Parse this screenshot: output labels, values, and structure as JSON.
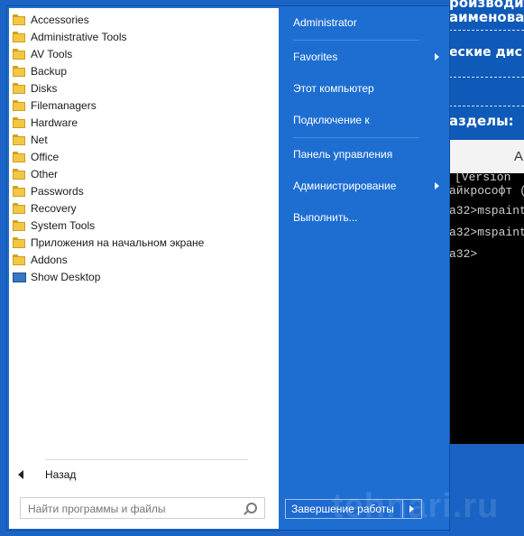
{
  "background_window": {
    "line1": "роизводит",
    "line2": "аименован",
    "line3": "еские дис",
    "line4": "азделы:",
    "titlebar_text": "А",
    "console_lines": [
      "[Version",
      "айкрософт (",
      "a32>mspaint",
      "a32>mspaint",
      "a32>"
    ]
  },
  "programs": [
    {
      "label": "Accessories",
      "icon": "folder-icon"
    },
    {
      "label": "Administrative Tools",
      "icon": "folder-icon"
    },
    {
      "label": "AV Tools",
      "icon": "folder-icon"
    },
    {
      "label": "Backup",
      "icon": "folder-icon"
    },
    {
      "label": "Disks",
      "icon": "folder-icon"
    },
    {
      "label": "Filemanagers",
      "icon": "folder-icon"
    },
    {
      "label": "Hardware",
      "icon": "folder-icon"
    },
    {
      "label": "Net",
      "icon": "folder-icon"
    },
    {
      "label": "Office",
      "icon": "folder-icon"
    },
    {
      "label": "Other",
      "icon": "folder-icon"
    },
    {
      "label": "Passwords",
      "icon": "folder-icon"
    },
    {
      "label": "Recovery",
      "icon": "folder-icon"
    },
    {
      "label": "System Tools",
      "icon": "folder-icon"
    },
    {
      "label": "Приложения на начальном экране",
      "icon": "folder-icon"
    },
    {
      "label": "Addons",
      "icon": "folder-icon"
    },
    {
      "label": "Show Desktop",
      "icon": "desktop-icon"
    }
  ],
  "back_label": "Назад",
  "search_placeholder": "Найти программы и файлы",
  "right_items": {
    "user": "Administrator",
    "favorites": "Favorites",
    "computer": "Этот компьютер",
    "connect": "Подключение к",
    "control_panel": "Панель управления",
    "admin": "Администрирование",
    "run": "Выполнить..."
  },
  "shutdown_label": "Завершение работы",
  "watermark": "tehnari.ru",
  "colors": {
    "menu_blue": "#1e6ed2",
    "panel_white": "#ffffff",
    "folder_yellow": "#f3c743"
  }
}
